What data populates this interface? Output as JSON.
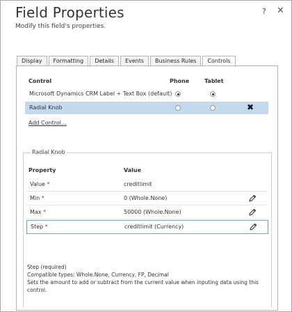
{
  "dialog": {
    "title": "Field Properties",
    "subtitle": "Modify this field's properties.",
    "help_label": "?",
    "close_label": "✕"
  },
  "tabs": [
    {
      "label": "Display"
    },
    {
      "label": "Formatting"
    },
    {
      "label": "Details"
    },
    {
      "label": "Events"
    },
    {
      "label": "Business Rules"
    },
    {
      "label": "Controls",
      "active": true
    }
  ],
  "controls": {
    "headers": {
      "control": "Control",
      "phone": "Phone",
      "tablet": "Tablet"
    },
    "rows": [
      {
        "name": "Microsoft Dynamics CRM Label + Text Box (default)",
        "phone": true,
        "tablet": true,
        "selected": false
      },
      {
        "name": "Radial Knob",
        "phone": false,
        "tablet": false,
        "selected": true,
        "delete_label": "✖"
      }
    ],
    "add_link": "Add Control..."
  },
  "properties": {
    "legend": "Radial Knob",
    "headers": {
      "property": "Property",
      "value": "Value"
    },
    "rows": [
      {
        "name": "Value",
        "required_mark": "*",
        "value": "creditlimit",
        "editable": false
      },
      {
        "name": "Min",
        "required_mark": "*",
        "value": "0 (Whole.None)",
        "editable": true
      },
      {
        "name": "Max",
        "required_mark": "*",
        "value": "50000 (Whole.None)",
        "editable": true
      },
      {
        "name": "Step",
        "required_mark": "*",
        "value": "creditlimit (Currency)",
        "editable": true,
        "active": true
      }
    ]
  },
  "description": {
    "line1": "Step (required)",
    "line2": "Compatible types: Whole.None, Currency, FP, Decimal",
    "line3": "Sets the amount to add or subtract from the current value when inputing data using this",
    "line4": "control."
  },
  "colors": {
    "selected_row": "#c5d9ee",
    "required": "#d6202a",
    "active_border": "#6f9fd1"
  }
}
